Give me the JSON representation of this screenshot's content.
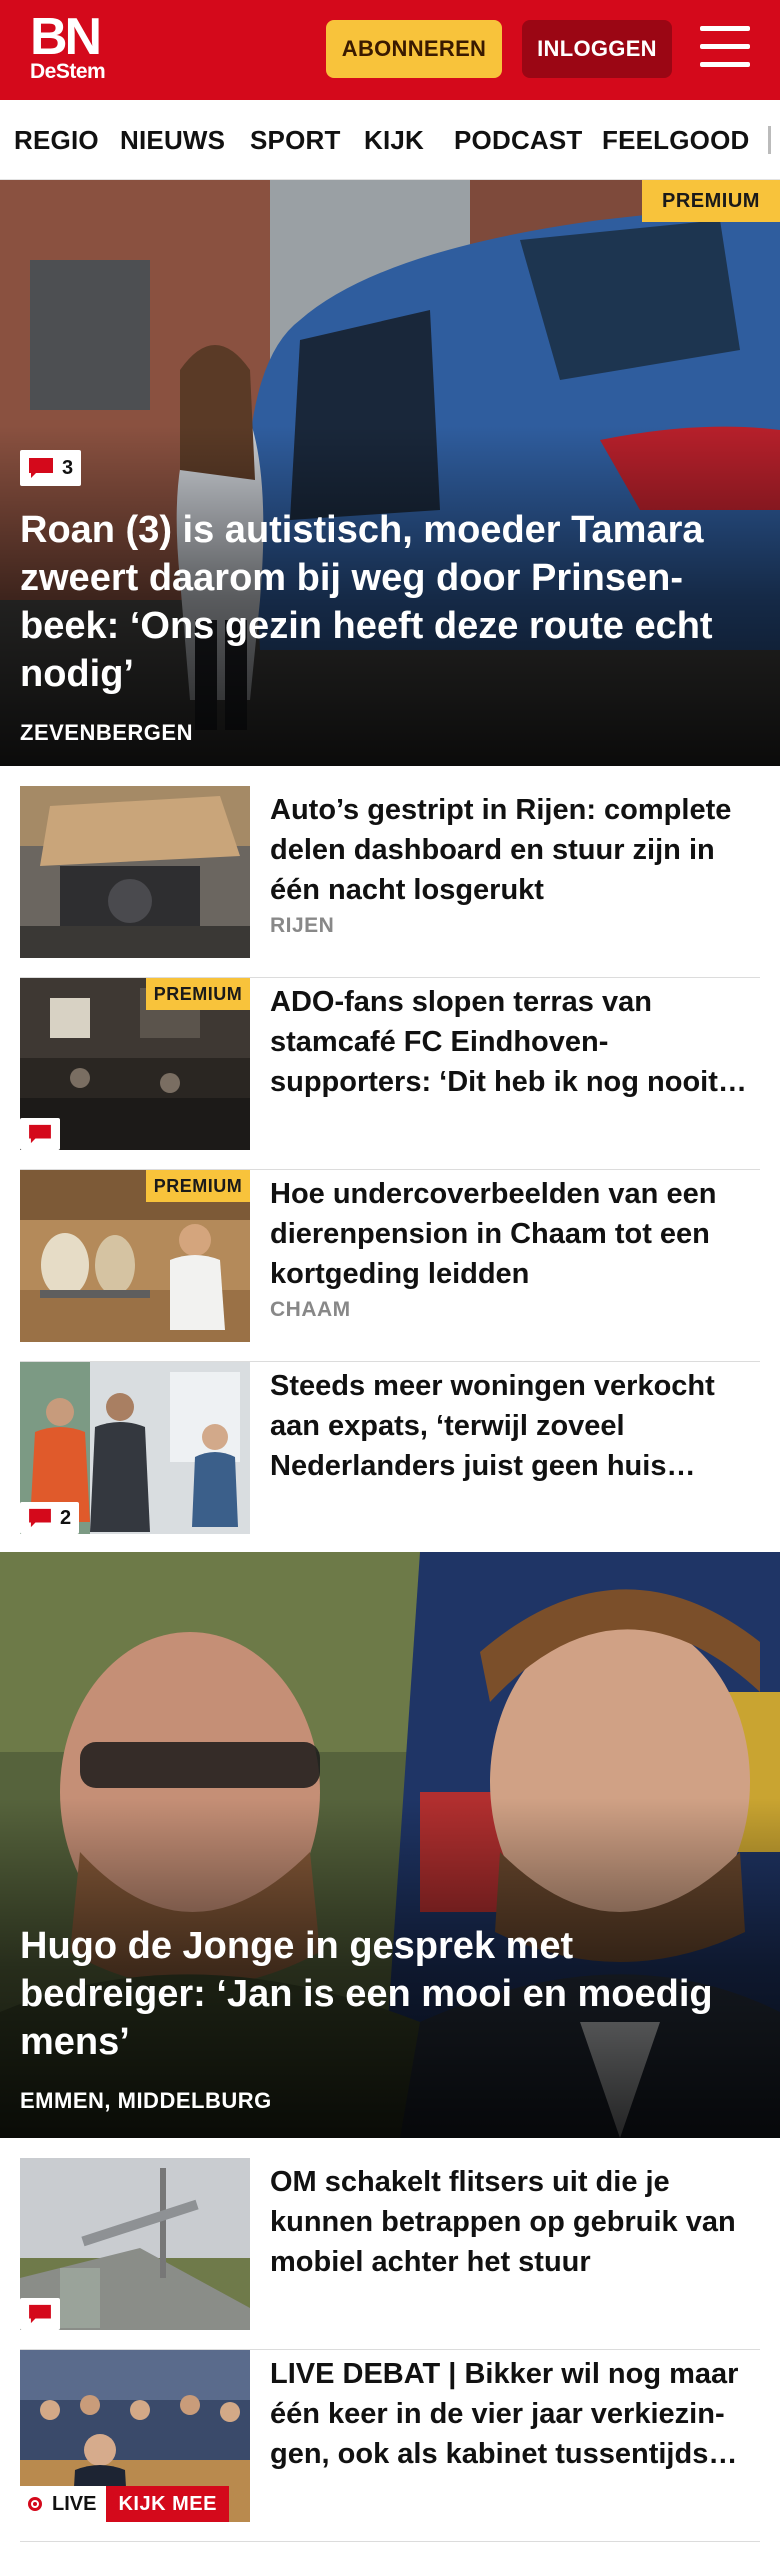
{
  "header": {
    "logo_main": "BN",
    "logo_sub": "DeStem",
    "subscribe_label": "ABONNEREN",
    "login_label": "INLOGGEN",
    "brand_color": "#d4091b",
    "accent_color": "#f8c33b"
  },
  "nav": {
    "items": [
      "REGIO",
      "NIEUWS",
      "SPORT",
      "KIJK",
      "PODCAST",
      "FEELGOOD"
    ]
  },
  "hero1": {
    "badge": "PREMIUM",
    "comments": "3",
    "title": "Roan (3) is autistisch, moeder Tamara zweert daarom bij weg door Prinsen­beek: ‘Ons gezin heeft deze route echt nodig’",
    "tag": "ZEVENBERGEN"
  },
  "articles": [
    {
      "title": "Auto’s gestript in Rijen: complete delen dashboard en stuur zijn in één nacht losgerukt",
      "tag": "RIJEN"
    },
    {
      "badge": "PREMIUM",
      "title": "ADO-fans slopen terras van stamcafé FC Eindhoven-supporters: ‘Dit heb ik nog nooit…"
    },
    {
      "badge": "PREMIUM",
      "title": "Hoe undercoverbeelden van een dierenpension in Chaam tot een kortgeding leidden",
      "tag": "CHAAM"
    },
    {
      "comments": "2",
      "title": "Steeds meer woningen verkocht aan expats, ‘terwijl zoveel Nederlanders juist geen huis…"
    }
  ],
  "hero2": {
    "title": "Hugo de Jonge in gesprek met bedreiger: ‘Jan is een mooi en moedig mens’",
    "tag": "EMMEN, MIDDELBURG"
  },
  "articles2": [
    {
      "title": "OM schakelt flitsers uit die je kunnen betrappen op gebruik van mobiel achter het stuur"
    },
    {
      "title": "LIVE DEBAT | Bikker wil nog maar één keer in de vier jaar verkiezin­gen, ook als kabinet tussentijds…",
      "live_label": "LIVE",
      "live_cta": "KIJK MEE"
    }
  ]
}
